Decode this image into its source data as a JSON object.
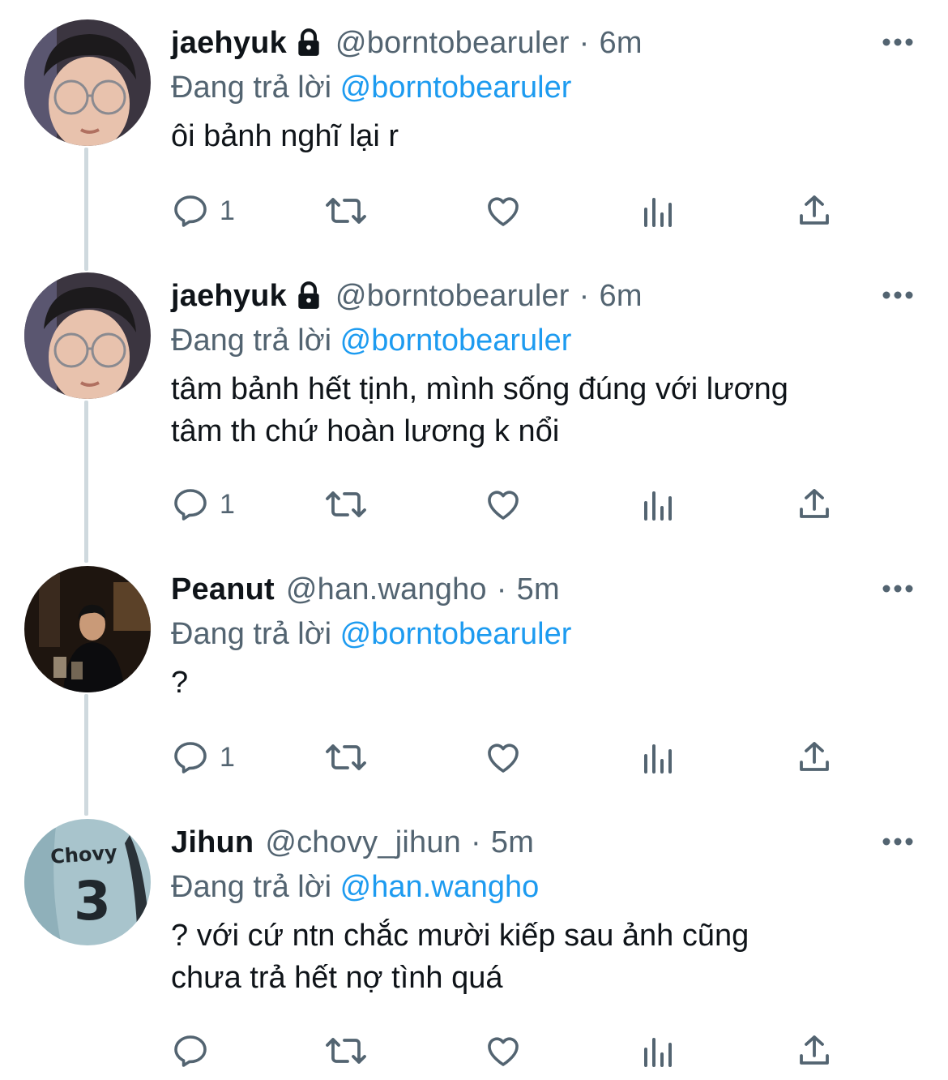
{
  "reply_prefix": "Đang trả lời",
  "colors": {
    "accent": "#1d9bf0",
    "muted": "#536471",
    "thread_line": "#cfd9de"
  },
  "tweets": [
    {
      "name": "jaehyuk",
      "protected": true,
      "handle": "@borntobearuler",
      "separator": "·",
      "time": "6m",
      "reply_to": "@borntobearuler",
      "text": "ôi bảnh nghĩ lại r",
      "reply_count": "1"
    },
    {
      "name": "jaehyuk",
      "protected": true,
      "handle": "@borntobearuler",
      "separator": "·",
      "time": "6m",
      "reply_to": "@borntobearuler",
      "text": "tâm bảnh hết tịnh, mình sống đúng với lương\ntâm th chứ hoàn lương k nổi",
      "reply_count": "1"
    },
    {
      "name": "Peanut",
      "protected": false,
      "handle": "@han.wangho",
      "separator": "·",
      "time": "5m",
      "reply_to": "@borntobearuler",
      "text": "?",
      "reply_count": "1"
    },
    {
      "name": "Jihun",
      "protected": false,
      "handle": "@chovy_jihun",
      "separator": "·",
      "time": "5m",
      "reply_to": "@han.wangho",
      "text": "? với cứ ntn chắc mười kiếp sau ảnh cũng\nchưa trả hết nợ tình quá",
      "reply_count": "",
      "avatar_text": {
        "name": "Chovy",
        "number": "3"
      }
    }
  ]
}
